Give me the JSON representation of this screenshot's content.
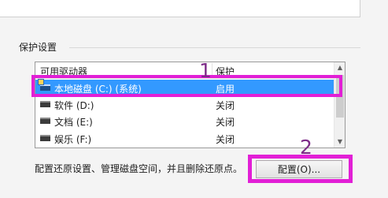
{
  "protection": {
    "group_title": "保护设置",
    "columns": {
      "drive": "可用驱动器",
      "protection": "保护"
    },
    "drives": [
      {
        "name": "本地磁盘 (C:) (系统)",
        "status": "启用",
        "selected": true
      },
      {
        "name": "软件 (D:)",
        "status": "关闭",
        "selected": false
      },
      {
        "name": "文档 (E:)",
        "status": "关闭",
        "selected": false
      },
      {
        "name": "娱乐 (F:)",
        "status": "关闭",
        "selected": false
      }
    ],
    "description": "配置还原设置、管理磁盘空间，并且删除还原点。",
    "configure_button": "配置(O)..."
  },
  "annotations": {
    "step_1": "1",
    "step_2": "2",
    "highlight_color": "#e21fd6",
    "number_color": "#7d2c88"
  },
  "colors": {
    "selection": "#3399ff"
  }
}
